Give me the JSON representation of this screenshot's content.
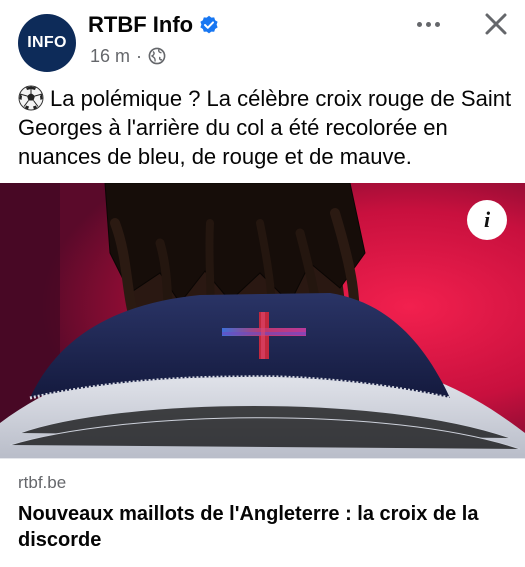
{
  "post": {
    "author": {
      "avatar_text": "INFO",
      "name": "RTBF Info",
      "verified": true,
      "verified_icon": "verified-badge-icon"
    },
    "meta": {
      "time": "16 m",
      "separator": "·",
      "audience_icon": "globe-icon"
    },
    "actions": {
      "more_icon": "more-options-icon",
      "close_icon": "close-icon"
    },
    "text": "La polémique ? La célèbre croix rouge de Saint Georges à l'arrière du col a été recolorée en nuances de bleu, de rouge et de mauve.",
    "text_emoji": "soccer-ball-icon",
    "link": {
      "domain": "rtbf.be",
      "headline": "Nouveaux maillots de l'Angleterre : la croix de la discorde",
      "info_label": "i"
    }
  },
  "colors": {
    "accent_verified": "#1877f2",
    "avatar_bg": "#0d2b59",
    "secondary_text": "#65676b",
    "image_background": "#c8103e",
    "collar_navy": "#1b2450"
  }
}
